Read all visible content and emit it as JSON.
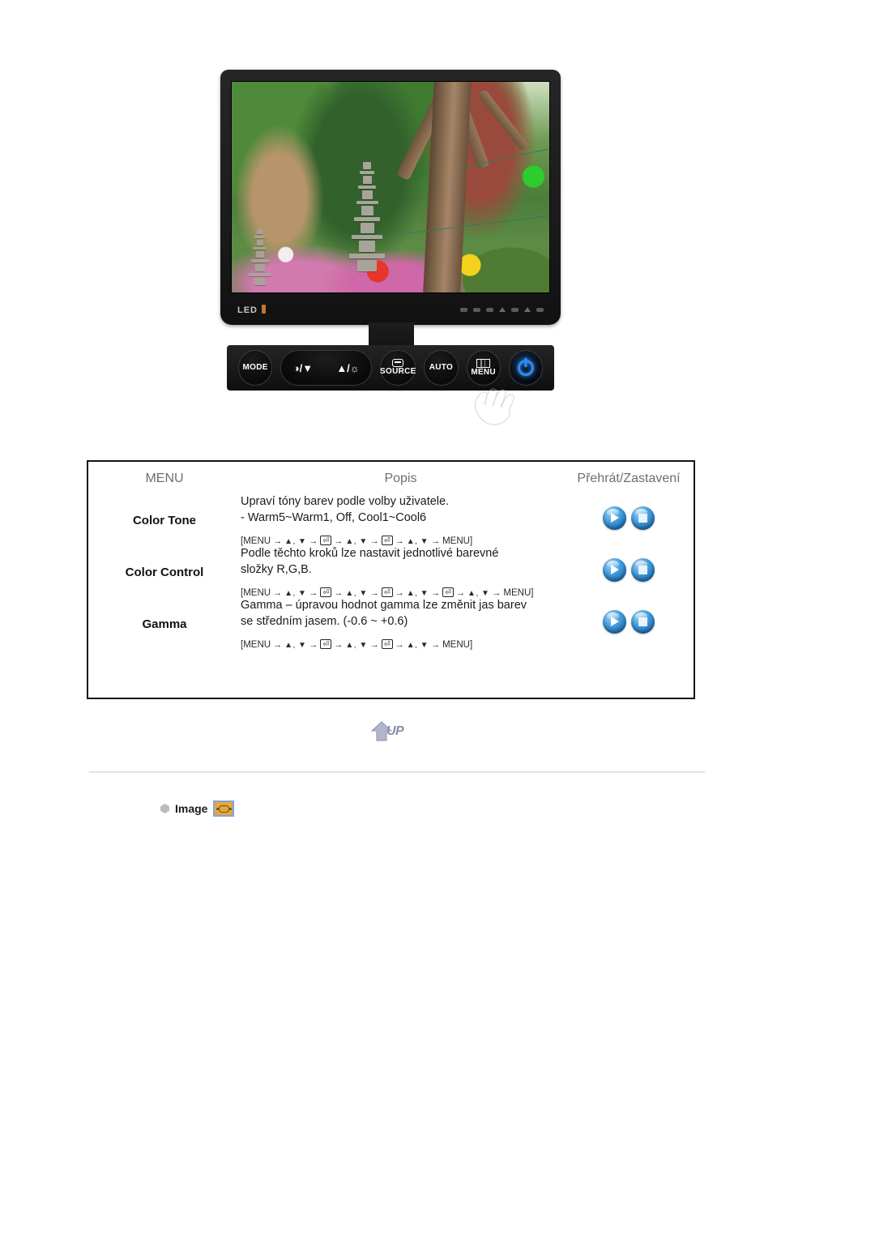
{
  "monitor": {
    "led_label": "LED",
    "buttons": {
      "mode": "MODE",
      "contrast_down": "◑/▼",
      "brightness_up": "▲/☼",
      "source": "SOURCE",
      "auto": "AUTO",
      "menu": "MENU",
      "power": "power-symbol"
    }
  },
  "table": {
    "headers": {
      "menu": "MENU",
      "description": "Popis",
      "play_stop": "Přehrát/Zastavení"
    },
    "rows": [
      {
        "menu": "Color Tone",
        "desc_line1": "Upraví tóny barev podle volby uživatele.",
        "desc_line2": "- Warm5~Warm1, Off, Cool1~Cool6",
        "sequence": [
          "[MENU",
          "→",
          "▲, ▼",
          "→",
          "⏎",
          "→",
          "▲, ▼",
          "→",
          "⏎",
          "→",
          "▲, ▼",
          "→",
          "MENU]"
        ],
        "play_label": "play-button",
        "stop_label": "stop-button"
      },
      {
        "menu": "Color Control",
        "desc_line1": "Podle těchto kroků lze nastavit jednotlivé barevné",
        "desc_line2": "složky R,G,B.",
        "sequence": [
          "[MENU",
          "→",
          "▲, ▼",
          "→",
          "⏎",
          "→",
          "▲, ▼",
          "→",
          "⏎",
          "→",
          "▲, ▼",
          "→",
          "⏎",
          "→",
          "▲, ▼",
          "→",
          "MENU]"
        ],
        "play_label": "play-button",
        "stop_label": "stop-button"
      },
      {
        "menu": "Gamma",
        "desc_line1": "Gamma – úpravou hodnot gamma lze změnit jas barev",
        "desc_line2": "se středním jasem. (-0.6 ~ +0.6)",
        "sequence": [
          "[MENU",
          "→",
          "▲, ▼",
          "→",
          "⏎",
          "→",
          "▲, ▼",
          "→",
          "⏎",
          "→",
          "▲, ▼",
          "→",
          "MENU]"
        ],
        "play_label": "play-button",
        "stop_label": "stop-button"
      }
    ]
  },
  "up_button": {
    "label": "UP"
  },
  "image_section": {
    "label": "Image"
  },
  "colors": {
    "header_text": "#6e6e6e",
    "body_text": "#1a1a1a",
    "orb_blue": "#1d6fb8",
    "image_icon_orange": "#f0a33c",
    "image_icon_border": "#7fa6d8",
    "led_amber": "#c4762a",
    "power_blue": "#2f8cf5",
    "divider": "#e3e3e3"
  }
}
